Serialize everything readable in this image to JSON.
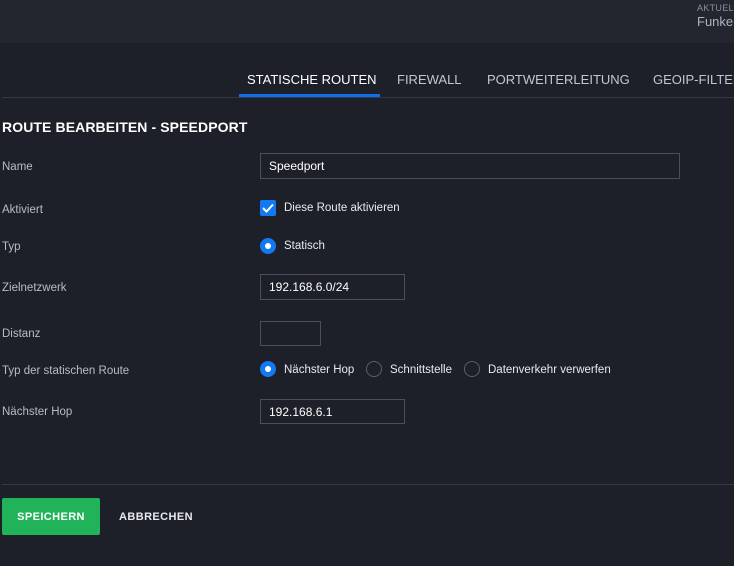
{
  "header": {
    "aktuel": "AKTUEL",
    "funke": "Funke"
  },
  "tabs": [
    {
      "label": "STATISCHE ROUTEN",
      "active": true
    },
    {
      "label": "FIREWALL"
    },
    {
      "label": "PORTWEITERLEITUNG"
    },
    {
      "label": "GEOIP-FILTER"
    }
  ],
  "form": {
    "title": "ROUTE BEARBEITEN - SPEEDPORT",
    "name": {
      "label": "Name",
      "value": "Speedport"
    },
    "activated": {
      "label": "Aktiviert",
      "option": "Diese Route aktivieren",
      "checked": true
    },
    "type": {
      "label": "Typ",
      "option": "Statisch"
    },
    "target_network": {
      "label": "Zielnetzwerk",
      "value": "192.168.6.0/24"
    },
    "distance": {
      "label": "Distanz",
      "value": ""
    },
    "static_route_type": {
      "label": "Typ der statischen Route",
      "options": [
        "Nächster Hop",
        "Schnittstelle",
        "Datenverkehr verwerfen"
      ],
      "selected": "Nächster Hop"
    },
    "next_hop": {
      "label": "Nächster Hop",
      "value": "192.168.6.1"
    }
  },
  "actions": {
    "save": "SPEICHERN",
    "cancel": "ABBRECHEN"
  },
  "colors": {
    "accent": "#1279f2",
    "save": "#21b35a",
    "background": "#1d2029"
  }
}
